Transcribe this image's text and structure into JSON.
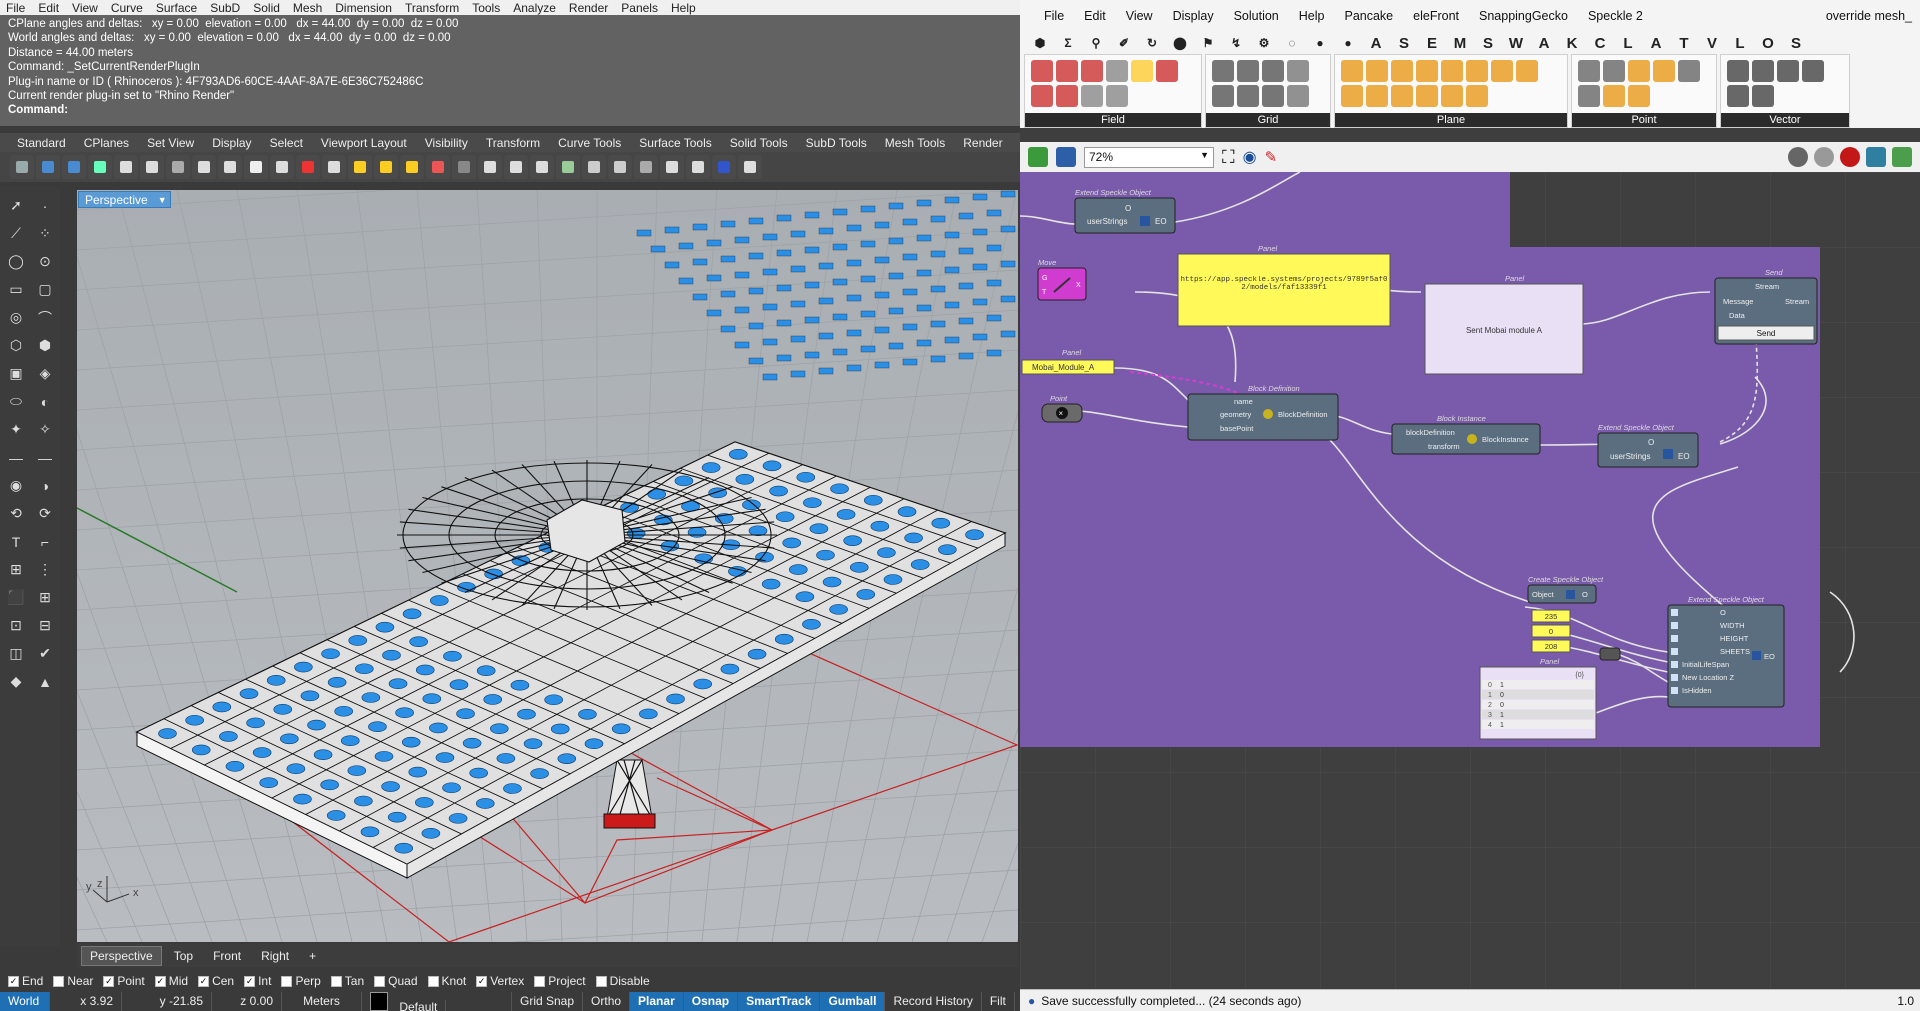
{
  "rhino": {
    "menu": [
      "File",
      "Edit",
      "View",
      "Curve",
      "Surface",
      "SubD",
      "Solid",
      "Mesh",
      "Dimension",
      "Transform",
      "Tools",
      "Analyze",
      "Render",
      "Panels",
      "Help"
    ],
    "command_history": [
      "CPlane angles and deltas:   xy = 0.00  elevation = 0.00   dx = 44.00  dy = 0.00  dz = 0.00",
      "World angles and deltas:   xy = 0.00  elevation = 0.00   dx = 44.00  dy = 0.00  dz = 0.00",
      "Distance = 44.00 meters",
      "Command: _SetCurrentRenderPlugIn",
      "Plug-in name or ID ( Rhinoceros ): 4F793AD6-60CE-4AAF-8A7E-6E36C752486C",
      "Current render plug-in set to \"Rhino Render\""
    ],
    "command_prompt": "Command:",
    "toolbar_tabs": [
      "Standard",
      "CPlanes",
      "Set View",
      "Display",
      "Select",
      "Viewport Layout",
      "Visibility",
      "Transform",
      "Curve Tools",
      "Surface Tools",
      "Solid Tools",
      "SubD Tools",
      "Mesh Tools",
      "Render"
    ],
    "viewport_label": "Perspective",
    "viewport_tabs": [
      "Perspective",
      "Top",
      "Front",
      "Right"
    ],
    "add_tab": "+",
    "osnaps": [
      {
        "label": "End",
        "checked": true
      },
      {
        "label": "Near",
        "checked": false
      },
      {
        "label": "Point",
        "checked": true
      },
      {
        "label": "Mid",
        "checked": true
      },
      {
        "label": "Cen",
        "checked": true
      },
      {
        "label": "Int",
        "checked": true
      },
      {
        "label": "Perp",
        "checked": false
      },
      {
        "label": "Tan",
        "checked": false
      },
      {
        "label": "Quad",
        "checked": false
      },
      {
        "label": "Knot",
        "checked": false
      },
      {
        "label": "Vertex",
        "checked": true
      },
      {
        "label": "Project",
        "checked": false
      },
      {
        "label": "Disable",
        "checked": false
      }
    ],
    "status": {
      "cplane": "World",
      "x": "x 3.92",
      "y": "y -21.85",
      "z": "z 0.00",
      "units": "Meters",
      "layer": "Default",
      "toggles": [
        "Grid Snap",
        "Ortho",
        "Planar",
        "Osnap",
        "SmartTrack",
        "Gumball",
        "Record History",
        "Filt"
      ],
      "toggles_on": [
        "Planar",
        "Osnap",
        "SmartTrack",
        "Gumball"
      ]
    },
    "axis_labels": {
      "x": "x",
      "y": "y",
      "z": "z"
    }
  },
  "grasshopper": {
    "menu": [
      "File",
      "Edit",
      "View",
      "Display",
      "Solution",
      "Help",
      "Pancake",
      "eleFront",
      "SnappingGecko",
      "Speckle 2"
    ],
    "override_label": "override mesh_",
    "tab_letters": [
      "A",
      "S",
      "E",
      "M",
      "S",
      "W",
      "A",
      "K",
      "C",
      "L",
      "A",
      "T",
      "V",
      "L",
      "O",
      "S"
    ],
    "ribbon_groups": [
      "Field",
      "Grid",
      "Plane",
      "Point",
      "Vector"
    ],
    "zoom": "72%",
    "status": "Save successfully completed... (24 seconds ago)",
    "status_right": "1.0",
    "components": {
      "extend1": {
        "title": "Extend Speckle Object",
        "in": "userStrings",
        "out": "EO",
        "o": "O"
      },
      "move": {
        "title": "Move",
        "g": "G",
        "t": "T",
        "x": "X"
      },
      "panel_url": {
        "title": "Panel",
        "text": "https://app.speckle.systems/projects/9789f5af02/models/faf13339f1"
      },
      "panel_sent": {
        "title": "Panel",
        "text": "Sent Mobai module A"
      },
      "send": {
        "title": "Send",
        "inputs": [
          "Stream",
          "Message",
          "Data"
        ],
        "out": "Stream",
        "button": "Send"
      },
      "panel_name": {
        "title": "Panel",
        "text": "Mobai_Module_A"
      },
      "point": {
        "title": "Point"
      },
      "block_def": {
        "title": "Block Definition",
        "inputs": [
          "name",
          "geometry",
          "basePoint"
        ],
        "out": "BlockDefinition"
      },
      "block_inst": {
        "title": "Block Instance",
        "inputs": [
          "blockDefinition",
          "transform"
        ],
        "out": "BlockInstance"
      },
      "extend2": {
        "title": "Extend Speckle Object",
        "in": "userStrings",
        "out": "EO",
        "o": "O"
      },
      "create": {
        "title": "Create Speckle Object",
        "in": "Object",
        "out": "O"
      },
      "values": [
        "235",
        "0",
        "208"
      ],
      "panel_list": {
        "title": "Panel",
        "header": "{0}",
        "rows": [
          [
            "0",
            "1"
          ],
          [
            "1",
            "0"
          ],
          [
            "2",
            "0"
          ],
          [
            "3",
            "1"
          ],
          [
            "4",
            "1"
          ]
        ]
      },
      "extend3": {
        "title": "Extend Speckle Object",
        "inputs": [
          "O",
          "WIDTH",
          "HEIGHT",
          "SHEETS",
          "InitialLifeSpan",
          "New Location Z",
          "IsHidden"
        ],
        "out": "EO"
      }
    }
  }
}
